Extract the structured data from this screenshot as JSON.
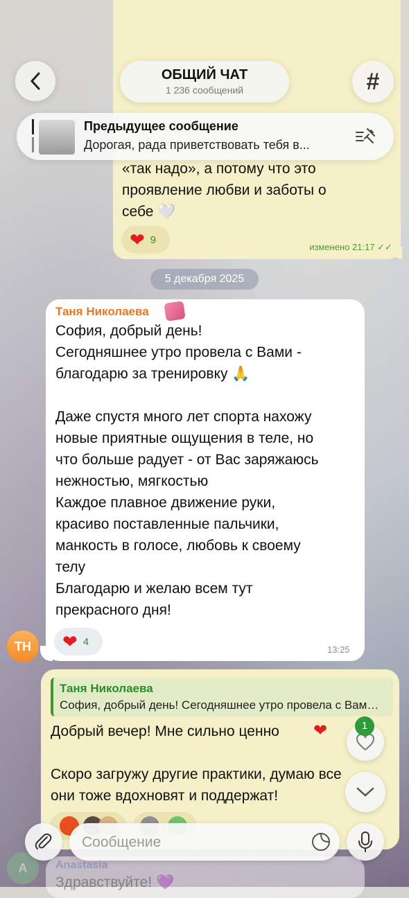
{
  "header": {
    "title": "ОБЩИЙ ЧАТ",
    "subtitle": "1 236 сообщений"
  },
  "pinned": {
    "title": "Предыдущее сообщение",
    "text": "Дорогая, рада приветствовать тебя в..."
  },
  "previous_message": {
    "visible_text": "«так надо», а потому что это\nпроявление любви и заботы о\nсебе 🤍",
    "reaction_count": "9",
    "meta": "изменено 21:17 ✓✓"
  },
  "date_separator": "5 декабря 2025",
  "incoming_message": {
    "sender": "Таня Николаева",
    "avatar_initials": "TH",
    "text": "София, добрый день!\nСегодняшнее утро провела с Вами -\nблагодарю за тренировку 🙏\n\nДаже спустя много лет спорта нахожу\nновые приятные ощущения в теле, но\nчто больше радует - от Вас заряжаюсь\nнежностью, мягкостью\nКаждое плавное движение руки,\nкрасиво поставленные пальчики,\nманкость в голосе, любовь к своему\nтелу\nБлагодарю и желаю всем тут\nпрекрасного дня!",
    "reaction_count": "4",
    "time": "13:25"
  },
  "reply_message": {
    "quote_sender": "Таня Николаева",
    "quote_text": "София, добрый день! Сегодняшнее утро провела с Вами - благодарю за тренировку",
    "text": "Добрый вечер! Мне сильно ценно\n\nСкоро загружу другие практики, думаю все\nони тоже вдохновят и поддержат!"
  },
  "floating": {
    "unread_reactions_badge": "1"
  },
  "composer": {
    "placeholder": "Сообщение"
  },
  "next_message": {
    "sender": "Anastasia",
    "avatar_initial": "A",
    "text": "Здравствуйте! 💜"
  },
  "colors": {
    "outgoing_bubble": "#f6f0c8",
    "incoming_bubble": "#ffffff",
    "accent_green": "#2e9b3a",
    "sender_orange": "#e0792a",
    "heart_red": "#e31d1d"
  },
  "icons": [
    "back-icon",
    "hash-icon",
    "pin-list-icon",
    "heart-icon",
    "chevron-down-icon",
    "paperclip-icon",
    "sticker-icon",
    "microphone-icon"
  ]
}
